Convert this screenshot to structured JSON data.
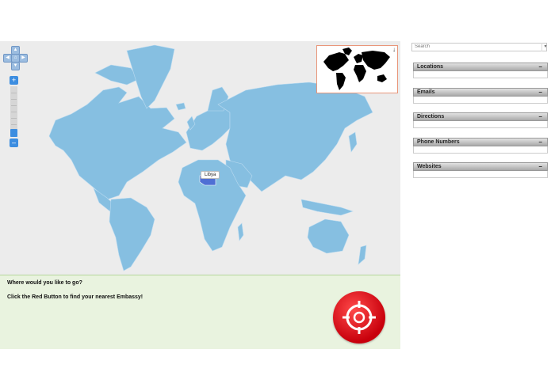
{
  "map": {
    "tooltip": "Libya",
    "land_color": "#86bfe1",
    "highlight_color": "#4f6fd4",
    "minimap_toggle": "↓"
  },
  "controls": {
    "pan_home": "⌂",
    "zoom_in": "+",
    "zoom_out": "–"
  },
  "info": {
    "question": "Where would you like to go?",
    "hint": "Click the Red Button to find your nearest Embassy!"
  },
  "sidebar": {
    "search_placeholder": "Search",
    "sections": [
      {
        "label": "Locations",
        "toggle": "–"
      },
      {
        "label": "Emails",
        "toggle": "–"
      },
      {
        "label": "Directions",
        "toggle": "–"
      },
      {
        "label": "Phone Numbers",
        "toggle": "–"
      },
      {
        "label": "Websites",
        "toggle": "–"
      }
    ]
  }
}
